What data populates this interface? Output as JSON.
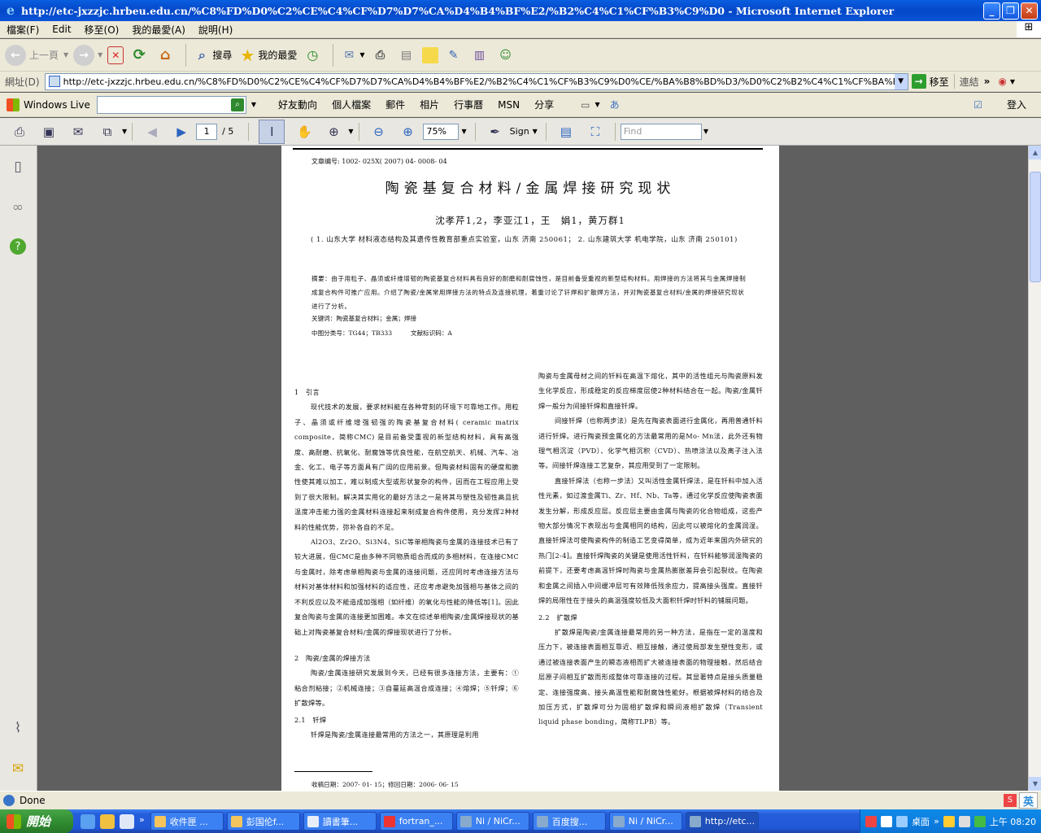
{
  "window": {
    "title": "http://etc-jxzzjc.hrbeu.edu.cn/%C8%FD%D0%C2%CE%C4%CF%D7%D7%CA%D4%B4%BF%E2/%B2%C4%C1%CF%B3%C9%D0 - Microsoft Internet Explorer",
    "minimize": "_",
    "maximize": "❐",
    "close": "✕"
  },
  "menu": [
    "檔案(F)",
    "Edit",
    "移至(O)",
    "我的最愛(A)",
    "說明(H)"
  ],
  "toolbar": {
    "back_label": "上一頁",
    "search_label": "搜尋",
    "favorites_label": "我的最愛"
  },
  "address": {
    "label": "網址(D)",
    "url": "http://etc-jxzzjc.hrbeu.edu.cn/%C8%FD%D0%C2%CE%C4%CF%D7%D7%CA%D4%B4%BF%E2/%B2%C4%C1%CF%B3%C9%D0%CE/%BA%B8%BD%D3/%D0%C2%B2%C4%C1%CF%BA%B8%BD%D3/%CC%",
    "go_label": "移至",
    "links_label": "連結"
  },
  "live": {
    "brand": "Windows Live",
    "search_placeholder": "",
    "links": [
      "好友動向",
      "個人檔案",
      "郵件",
      "相片",
      "行事曆",
      "MSN",
      "分享"
    ],
    "signin": "登入"
  },
  "pdf_toolbar": {
    "current_page": "1",
    "total_pages": "/ 5",
    "zoom": "75%",
    "sign_label": "Sign",
    "find_placeholder": "Find"
  },
  "paper": {
    "article_no": "文章编号: 1002- 025X( 2007) 04- 0008- 04",
    "title": "陶瓷基复合材料/金属焊接研究现状",
    "authors": "沈孝芹1,2，李亚江1，王　娟1，黄万群1",
    "affiliation": "( 1. 山东大学 材料液态结构及其遗传性教育部重点实验室，山东 济南 250061； 2. 山东建筑大学 机电学院，山东 济南 250101)",
    "abstract": "摘要：由于用粒子、晶须或纤维增韧的陶瓷基复合材料具有良好的耐磨和耐腐蚀性，是目前备受重视的新型结构材料。用焊接的方法将其与金属焊接制成复合构件可推广应用。介绍了陶瓷/金属常用焊接方法的特点及连接机理，着重讨论了钎焊和扩散焊方法，并对陶瓷基复合材料/金属的焊接研究现状进行了分析。",
    "keywords": "关键词：陶瓷基复合材料；金属；焊接",
    "classification": "中图分类号：TG44；TB333　　　文献标识码：A",
    "left_col": [
      {
        "type": "h",
        "text": "1　引言"
      },
      {
        "type": "p",
        "text": "现代技术的发展，要求材料能在各种苛刻的环境下可靠地工作。用粒子、晶须或纤维增强韧强的陶瓷基复合材料( ceramic matrix composite，简称CMC) 是目前备受重视的新型结构材料，具有高强度、高耐磨、抗氧化、耐腐蚀等优良性能，在航空航天、机械、汽车、冶金、化工、电子等方面具有广阔的应用前景。但陶瓷材料固有的硬度和脆性使其难以加工，难以制成大型或形状复杂的构件，因而在工程应用上受到了很大限制。解决其实用化的最好方法之一是将其与塑性及韧性高且抗温度冲击能力强的金属材料连接起来制成复合构件使用，充分发挥2种材料的性能优势，弥补各自的不足。"
      },
      {
        "type": "p",
        "text": "Al2O3、Zr2O、Si3N4、SiC等单相陶瓷与金属的连接技术已有了较大进展，但CMC是由多种不同物质组合而成的多相材料，在连接CMC与金属时，除考虑单相陶瓷与金属的连接问题，还应同时考虑连接方法与材料对基体材料和加强材料的适应性，还应考虑避免加强相与基体之间的不利反应以及不能造成加强相（如纤维）的氧化与性能的降低等[1]。因此复合陶瓷与金属的连接更加困难。本文在综述单相陶瓷/金属焊接现状的基础上对陶瓷基复合材料/金属的焊接现状进行了分析。"
      },
      {
        "type": "hgap",
        "text": "2　陶瓷/金属的焊接方法"
      },
      {
        "type": "p",
        "text": "陶瓷/金属连接研究发展到今天，已经有很多连接方法，主要有：①粘合剂粘接；②机械连接；③自蔓延高温合成连接；④熔焊；⑤钎焊；⑥扩散焊等。"
      },
      {
        "type": "h",
        "text": "2.1　钎焊"
      },
      {
        "type": "p",
        "text": "钎焊是陶瓷/金属连接最常用的方法之一，其原理是利用"
      }
    ],
    "right_col": [
      {
        "type": "p0",
        "text": "陶瓷与金属母材之间的钎料在高温下熔化，其中的活性组元与陶瓷原料发生化学反应，形成稳定的反应梯度层使2种材料结合在一起。陶瓷/金属钎焊一般分为间接钎焊和直接钎焊。"
      },
      {
        "type": "p",
        "text": "间接钎焊（也称两步法）是先在陶瓷表面进行金属化，再用普通钎料进行钎焊。进行陶瓷预金属化的方法最常用的是Mo- Mn法，此外还有物理气相沉淀（PVD）、化学气相沉积（CVD）、热喷涂法以及离子注入法等。间接钎焊连接工艺复杂，其应用受到了一定限制。"
      },
      {
        "type": "p",
        "text": "直接钎焊法（也称一步法）又叫活性金属钎焊法，是在钎料中加入活性元素，如过渡金属Ti、Zr、Hf、Nb、Ta等，通过化学反应使陶瓷表面发生分解，形成反应层。反应层主要由金属与陶瓷的化合物组成，这些产物大部分情况下表现出与金属相同的结构，因此可以被熔化的金属润湿。直接钎焊法可使陶瓷构件的制造工艺变得简单，成为近年来国内外研究的热门[2-4]。直接钎焊陶瓷的关键是使用活性钎料，在钎料能够润湿陶瓷的前提下，还要考虑高温钎焊时陶瓷与金属热膨胀差异会引起裂纹。在陶瓷和金属之间插入中间缓冲层可有效降低残余应力，提高接头强度。直接钎焊的局限性在于接头的高温强度较低及大面积钎焊时钎料的铺展问题。"
      },
      {
        "type": "h",
        "text": "2.2　扩散焊"
      },
      {
        "type": "p",
        "text": "扩散焊是陶瓷/金属连接最常用的另一种方法，是指在一定的温度和压力下，被连接表面相互靠近、相互接触，通过使局部发生塑性变形，或通过被连接表面产生的瞬态液相而扩大被连接表面的物理接触，然后结合层原子间相互扩散而形成整体可靠连接的过程。其显著特点是接头质量稳定、连接强度高、接头高温性能和耐腐蚀性能好。根据被焊材料的结合及加压方式，扩散焊可分为固相扩散焊和瞬间液相扩散焊（Transient liquid phase bonding，简称TLPB）等。"
      }
    ],
    "footer": "收稿日期：2007- 01- 15；修回日期：2006- 06- 15"
  },
  "status": {
    "text": "Done",
    "ime": "英"
  },
  "taskbar": {
    "start": "開始",
    "tasks": [
      "收件匣 ...",
      "彭国伦f...",
      "讀書筆...",
      "fortran_...",
      "Ni / NiCr...",
      "百度搜...",
      "Ni / NiCr...",
      "http://etc..."
    ],
    "active_index": 7,
    "tray_text": "桌面",
    "clock": "上午 08:20"
  }
}
